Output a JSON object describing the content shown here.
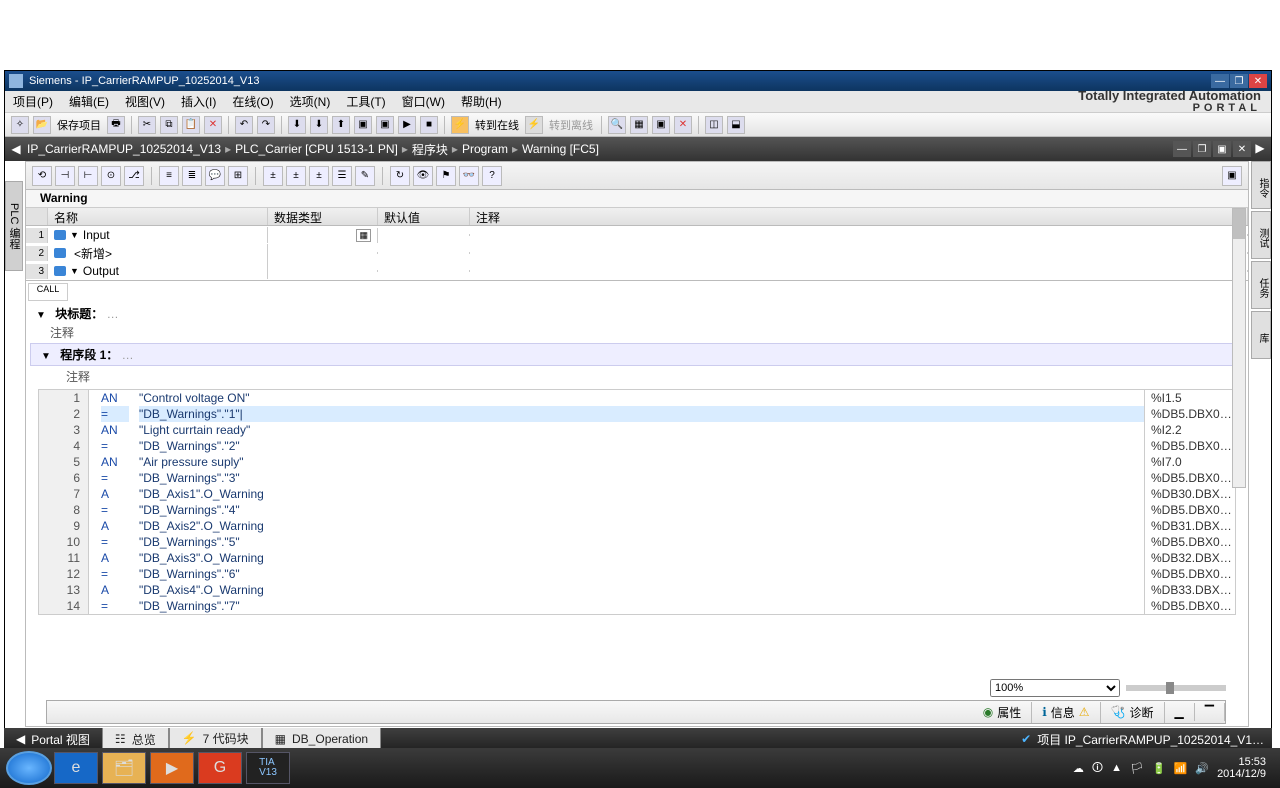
{
  "window": {
    "title": "Siemens  -  IP_CarrierRAMPUP_10252014_V13",
    "brand_line1": "Totally Integrated Automation",
    "brand_line2": "PORTAL"
  },
  "menu": [
    "项目(P)",
    "编辑(E)",
    "视图(V)",
    "插入(I)",
    "在线(O)",
    "选项(N)",
    "工具(T)",
    "窗口(W)",
    "帮助(H)"
  ],
  "toolbar1": {
    "save": "保存项目",
    "go_online": "转到在线",
    "go_offline": "转到离线"
  },
  "breadcrumb": [
    "IP_CarrierRAMPUP_10252014_V13",
    "PLC_Carrier [CPU 1513-1 PN]",
    "程序块",
    "Program",
    "Warning [FC5]"
  ],
  "left_rail": "PLC 编程",
  "right_rail": [
    "指令",
    "测试",
    "任务",
    "库"
  ],
  "editor": {
    "block_name": "Warning",
    "if_cols": [
      "",
      "名称",
      "数据类型",
      "默认值",
      "注释"
    ],
    "if_rows": [
      {
        "n": "1",
        "gut": true,
        "tri": "▼",
        "name": "Input",
        "type": "",
        "def": "",
        "cm": ""
      },
      {
        "n": "2",
        "gut": true,
        "tri": "",
        "name": "    <新增>",
        "type": "",
        "def": "",
        "cm": ""
      },
      {
        "n": "3",
        "gut": true,
        "tri": "▼",
        "name": "Output",
        "type": "",
        "def": "",
        "cm": ""
      }
    ],
    "call": "CALL",
    "block_title": "块标题：",
    "comment": "注释",
    "network_title": "程序段 1：",
    "network_comment": "注释"
  },
  "code": {
    "lines": [
      {
        "ln": 1,
        "op": "AN",
        "operand": "\"Control voltage ON\"",
        "addr": "%I1.5"
      },
      {
        "ln": 2,
        "op": "=",
        "operand": "\"DB_Warnings\".\"1\"",
        "addr": "%DB5.DBX0…",
        "sel": true
      },
      {
        "ln": 3,
        "op": "AN",
        "operand": "\"Light currtain ready\"",
        "addr": "%I2.2"
      },
      {
        "ln": 4,
        "op": "=",
        "operand": "\"DB_Warnings\".\"2\"",
        "addr": "%DB5.DBX0…"
      },
      {
        "ln": 5,
        "op": "AN",
        "operand": "\"Air pressure suply\"",
        "addr": "%I7.0"
      },
      {
        "ln": 6,
        "op": "=",
        "operand": "\"DB_Warnings\".\"3\"",
        "addr": "%DB5.DBX0…"
      },
      {
        "ln": 7,
        "op": "A",
        "operand": "\"DB_Axis1\".O_Warning",
        "addr": "%DB30.DBX…"
      },
      {
        "ln": 8,
        "op": "=",
        "operand": "\"DB_Warnings\".\"4\"",
        "addr": "%DB5.DBX0…"
      },
      {
        "ln": 9,
        "op": "A",
        "operand": "\"DB_Axis2\".O_Warning",
        "addr": "%DB31.DBX…"
      },
      {
        "ln": 10,
        "op": "=",
        "operand": "\"DB_Warnings\".\"5\"",
        "addr": "%DB5.DBX0…"
      },
      {
        "ln": 11,
        "op": "A",
        "operand": "\"DB_Axis3\".O_Warning",
        "addr": "%DB32.DBX…"
      },
      {
        "ln": 12,
        "op": "=",
        "operand": "\"DB_Warnings\".\"6\"",
        "addr": "%DB5.DBX0…"
      },
      {
        "ln": 13,
        "op": "A",
        "operand": "\"DB_Axis4\".O_Warning",
        "addr": "%DB33.DBX…"
      },
      {
        "ln": 14,
        "op": "=",
        "operand": "\"DB_Warnings\".\"7\"",
        "addr": "%DB5.DBX0…"
      }
    ]
  },
  "zoom": "100%",
  "prop_tabs": {
    "properties": "属性",
    "info": "信息",
    "diagnostics": "诊断"
  },
  "bottom_tabs": {
    "portal_view": "Portal 视图",
    "overview": "总览",
    "code_block": "7 代码块",
    "db": "DB_Operation"
  },
  "status": "项目 IP_CarrierRAMPUP_10252014_V1…",
  "tray": {
    "time": "15:53",
    "date": "2014/12/9"
  }
}
